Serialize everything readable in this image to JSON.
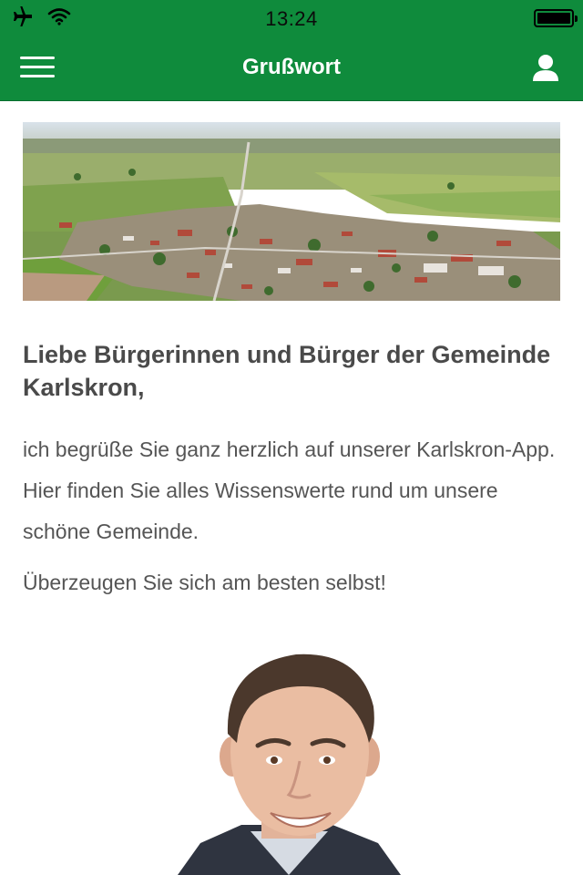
{
  "status_bar": {
    "time": "13:24",
    "icons": [
      "airplane-icon",
      "wifi-icon",
      "battery-icon"
    ]
  },
  "nav": {
    "title": "Grußwort",
    "menu_icon": "hamburger-icon",
    "user_icon": "user-icon"
  },
  "article": {
    "hero_image": "aerial-village-photo",
    "headline": "Liebe Bürgerinnen und Bürger der Gemeinde Karlskron,",
    "paragraph_1": "ich begrüße Sie ganz herzlich auf unserer Karlskron-App. Hier finden Sie alles Wissenswerte rund um unsere schöne Gemeinde.",
    "paragraph_2": "Überzeugen Sie sich am besten selbst!",
    "portrait_image": "mayor-portrait-photo"
  },
  "colors": {
    "brand_green": "#0f8b3c",
    "text_dark": "#4a4a4a",
    "text_body": "#555555"
  }
}
